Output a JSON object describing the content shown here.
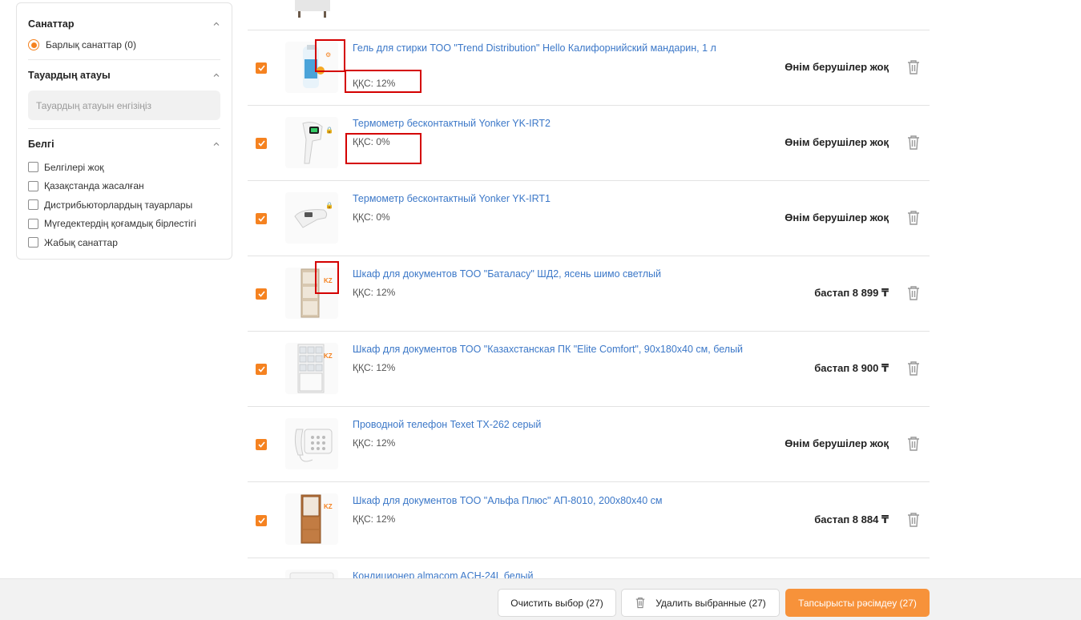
{
  "filters": {
    "categories": {
      "title": "Санаттар",
      "options": [
        {
          "label": "Барлық санаттар (0)",
          "selected": true
        }
      ]
    },
    "product_name": {
      "title": "Тауардың атауы",
      "placeholder": "Тауардың атауын енгізіңіз"
    },
    "marks": {
      "title": "Белгі",
      "options": [
        {
          "label": "Белгілері жоқ"
        },
        {
          "label": "Қазақстанда жасалған"
        },
        {
          "label": "Дистрибьюторлардың тауарлары"
        },
        {
          "label": "Мүгедектердің қоғамдық бірлестігі"
        },
        {
          "label": "Жабық санаттар"
        }
      ]
    }
  },
  "products": [
    {
      "title": "Гель для стирки ТОО \"Trend Distribution\" Hello Калифорнийский мандарин, 1 л",
      "vat": "ҚҚС: 12%",
      "price": "Өнім берушілер жоқ",
      "badge": "⚙",
      "checked": true
    },
    {
      "title": "Термометр бесконтактный Yonker YK-IRT2",
      "vat": "ҚҚС: 0%",
      "price": "Өнім берушілер жоқ",
      "badge": "🔒",
      "checked": true
    },
    {
      "title": "Термометр бесконтактный Yonker YK-IRT1",
      "vat": "ҚҚС: 0%",
      "price": "Өнім берушілер жоқ",
      "badge": "🔒",
      "checked": true
    },
    {
      "title": "Шкаф для документов ТОО \"Баталасу\" ШД2, ясень шимо светлый",
      "vat": "ҚҚС: 12%",
      "price": "бастап 8 899 ₸",
      "badge": "KZ",
      "checked": true
    },
    {
      "title": "Шкаф для документов ТОО \"Казахстанская ПК \"Elite Comfort\", 90x180x40 см, белый",
      "vat": "ҚҚС: 12%",
      "price": "бастап 8 900 ₸",
      "badge": "KZ",
      "checked": true
    },
    {
      "title": "Проводной телефон Texet TX-262 серый",
      "vat": "ҚҚС: 12%",
      "price": "Өнім берушілер жоқ",
      "badge": "",
      "checked": true
    },
    {
      "title": "Шкаф для документов ТОО \"Альфа Плюс\" АП-8010, 200х80х40 см",
      "vat": "ҚҚС: 12%",
      "price": "бастап 8 884 ₸",
      "badge": "KZ",
      "checked": true
    },
    {
      "title": "Кондиционер almacom ACH-24L белый"
    }
  ],
  "actions": {
    "clear": "Очистить выбор (27)",
    "delete": "Удалить выбранные (27)",
    "order": "Тапсырысты рәсімдеу (27)"
  },
  "colors": {
    "accent": "#f58220",
    "link": "#3c78c8",
    "highlight": "#d40000"
  }
}
